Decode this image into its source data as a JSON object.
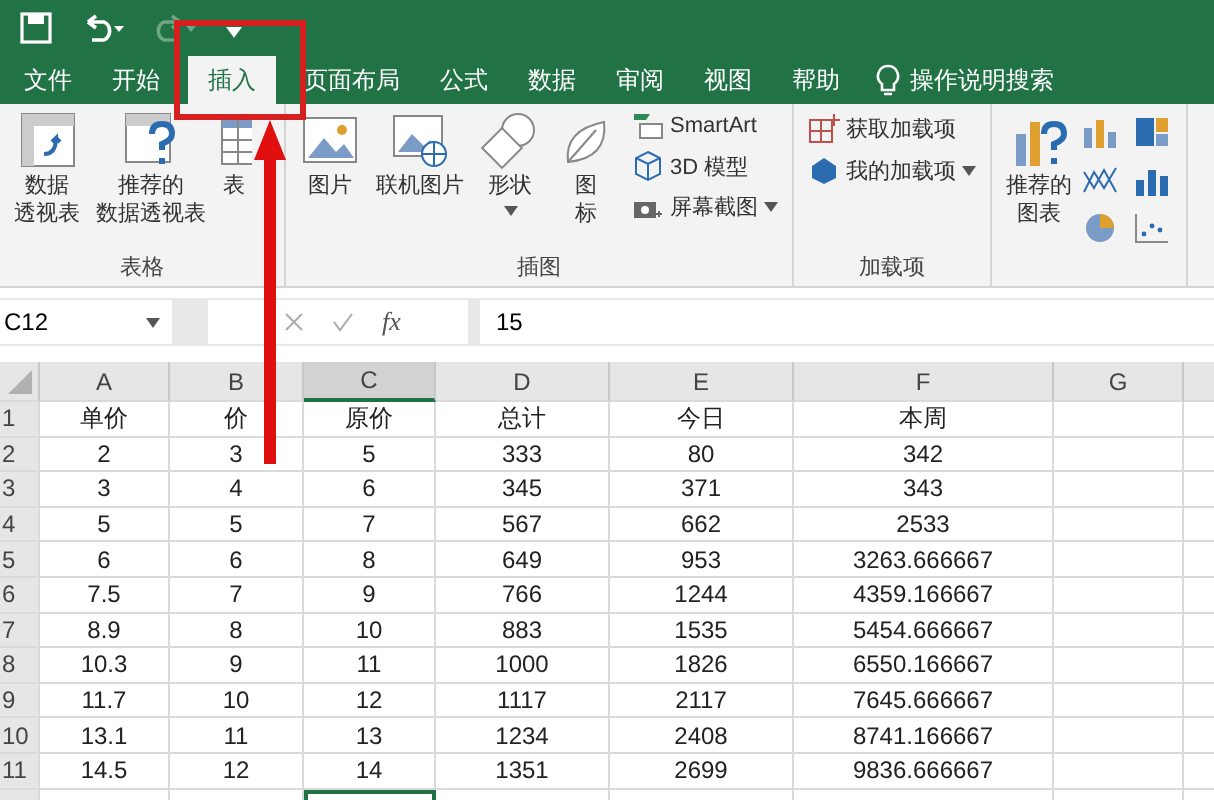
{
  "tabs": [
    {
      "label": "文件",
      "selected": false
    },
    {
      "label": "开始",
      "selected": false
    },
    {
      "label": "插入",
      "selected": true
    },
    {
      "label": "页面布局",
      "selected": false
    },
    {
      "label": "公式",
      "selected": false
    },
    {
      "label": "数据",
      "selected": false
    },
    {
      "label": "审阅",
      "selected": false
    },
    {
      "label": "视图",
      "selected": false
    },
    {
      "label": "帮助",
      "selected": false
    }
  ],
  "search_hint": "操作说明搜索",
  "ribbon": {
    "groups": [
      {
        "label": "表格",
        "items": [
          {
            "lines": [
              "数据",
              "透视表"
            ],
            "kind": "large",
            "dropdown": false
          },
          {
            "lines": [
              "推荐的",
              "数据透视表"
            ],
            "kind": "large",
            "dropdown": false
          },
          {
            "lines": [
              "表"
            ],
            "kind": "large",
            "dropdown": false
          }
        ]
      },
      {
        "label": "插图",
        "items": [
          {
            "lines": [
              "图片"
            ],
            "kind": "large",
            "dropdown": false
          },
          {
            "lines": [
              "联机图片"
            ],
            "kind": "large",
            "dropdown": false
          },
          {
            "lines": [
              "形状"
            ],
            "kind": "large",
            "dropdown": true
          },
          {
            "lines": [
              "图",
              "标"
            ],
            "kind": "large",
            "dropdown": false
          },
          {
            "label": "SmartArt",
            "kind": "small",
            "dropdown": false
          },
          {
            "label": "3D 模型",
            "kind": "small",
            "dropdown": false
          },
          {
            "label": "屏幕截图",
            "kind": "small",
            "dropdown": true
          }
        ]
      },
      {
        "label": "加载项",
        "items": [
          {
            "label": "获取加载项",
            "kind": "small",
            "dropdown": false
          },
          {
            "label": "我的加载项",
            "kind": "small",
            "dropdown": true
          }
        ]
      },
      {
        "items": [
          {
            "lines": [
              "推荐的",
              "图表"
            ],
            "kind": "large",
            "dropdown": false
          }
        ]
      }
    ]
  },
  "formula_bar": {
    "name_box": "C12",
    "fx": "fx",
    "value": "15"
  },
  "sheet": {
    "columns": [
      {
        "label": "A",
        "selected": false
      },
      {
        "label": "B",
        "selected": false
      },
      {
        "label": "C",
        "selected": true
      },
      {
        "label": "D",
        "selected": false
      },
      {
        "label": "E",
        "selected": false
      },
      {
        "label": "F",
        "selected": false
      },
      {
        "label": "G",
        "selected": false
      }
    ],
    "rows": [
      {
        "header": "1",
        "cells": [
          "单价",
          "价",
          "原价",
          "总计",
          "今日",
          "本周"
        ]
      },
      {
        "header": "2",
        "cells": [
          "2",
          "3",
          "5",
          "333",
          "80",
          "342"
        ]
      },
      {
        "header": "3",
        "cells": [
          "3",
          "4",
          "6",
          "345",
          "371",
          "343"
        ]
      },
      {
        "header": "4",
        "cells": [
          "5",
          "5",
          "7",
          "567",
          "662",
          "2533"
        ]
      },
      {
        "header": "5",
        "cells": [
          "6",
          "6",
          "8",
          "649",
          "953",
          "3263.666667"
        ]
      },
      {
        "header": "6",
        "cells": [
          "7.5",
          "7",
          "9",
          "766",
          "1244",
          "4359.166667"
        ]
      },
      {
        "header": "7",
        "cells": [
          "8.9",
          "8",
          "10",
          "883",
          "1535",
          "5454.666667"
        ]
      },
      {
        "header": "8",
        "cells": [
          "10.3",
          "9",
          "11",
          "1000",
          "1826",
          "6550.166667"
        ]
      },
      {
        "header": "9",
        "cells": [
          "11.7",
          "10",
          "12",
          "1117",
          "2117",
          "7645.666667"
        ]
      },
      {
        "header": "10",
        "cells": [
          "13.1",
          "11",
          "13",
          "1234",
          "2408",
          "8741.166667"
        ]
      },
      {
        "header": "11",
        "cells": [
          "14.5",
          "12",
          "14",
          "1351",
          "2699",
          "9836.666667"
        ]
      }
    ]
  }
}
